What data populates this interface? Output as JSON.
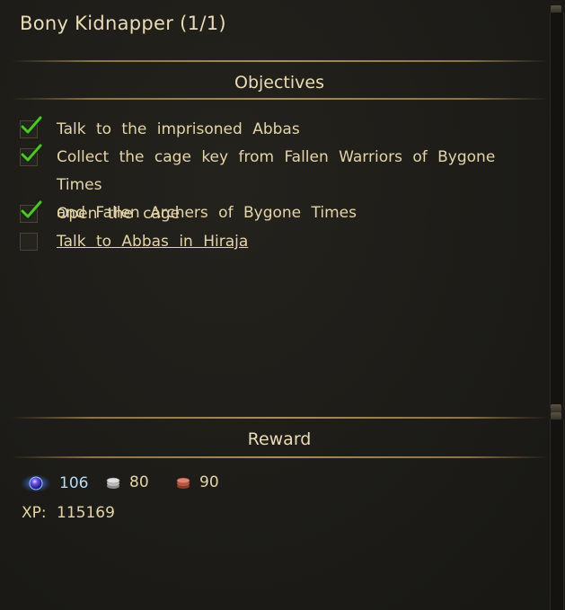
{
  "quest": {
    "title": "Bony Kidnapper (1/1)"
  },
  "objectives": {
    "header": "Objectives",
    "items": [
      {
        "text": "Talk to the imprisoned Abbas",
        "done": true
      },
      {
        "text": "Collect the cage key from Fallen Warriors of Bygone Times",
        "text2": "and Fallen Archers of Bygone Times",
        "done": true
      },
      {
        "text": "Open the cage",
        "done": true
      },
      {
        "text": "Talk to Abbas in Hiraja",
        "done": false,
        "link": true
      }
    ]
  },
  "reward": {
    "header": "Reward",
    "mana_orb": "106",
    "silver": "80",
    "copper": "90",
    "xp_label": "XP:",
    "xp_value": "115169"
  },
  "icons": {
    "check": "check-icon",
    "orb": "blue-orb-icon",
    "silver": "silver-coins-icon",
    "copper": "copper-coins-icon"
  },
  "colors": {
    "text": "#e4d4a8",
    "orb_value": "#b9dcf5",
    "check_green": "#4fbf2a",
    "divider": "#a88e5a"
  }
}
